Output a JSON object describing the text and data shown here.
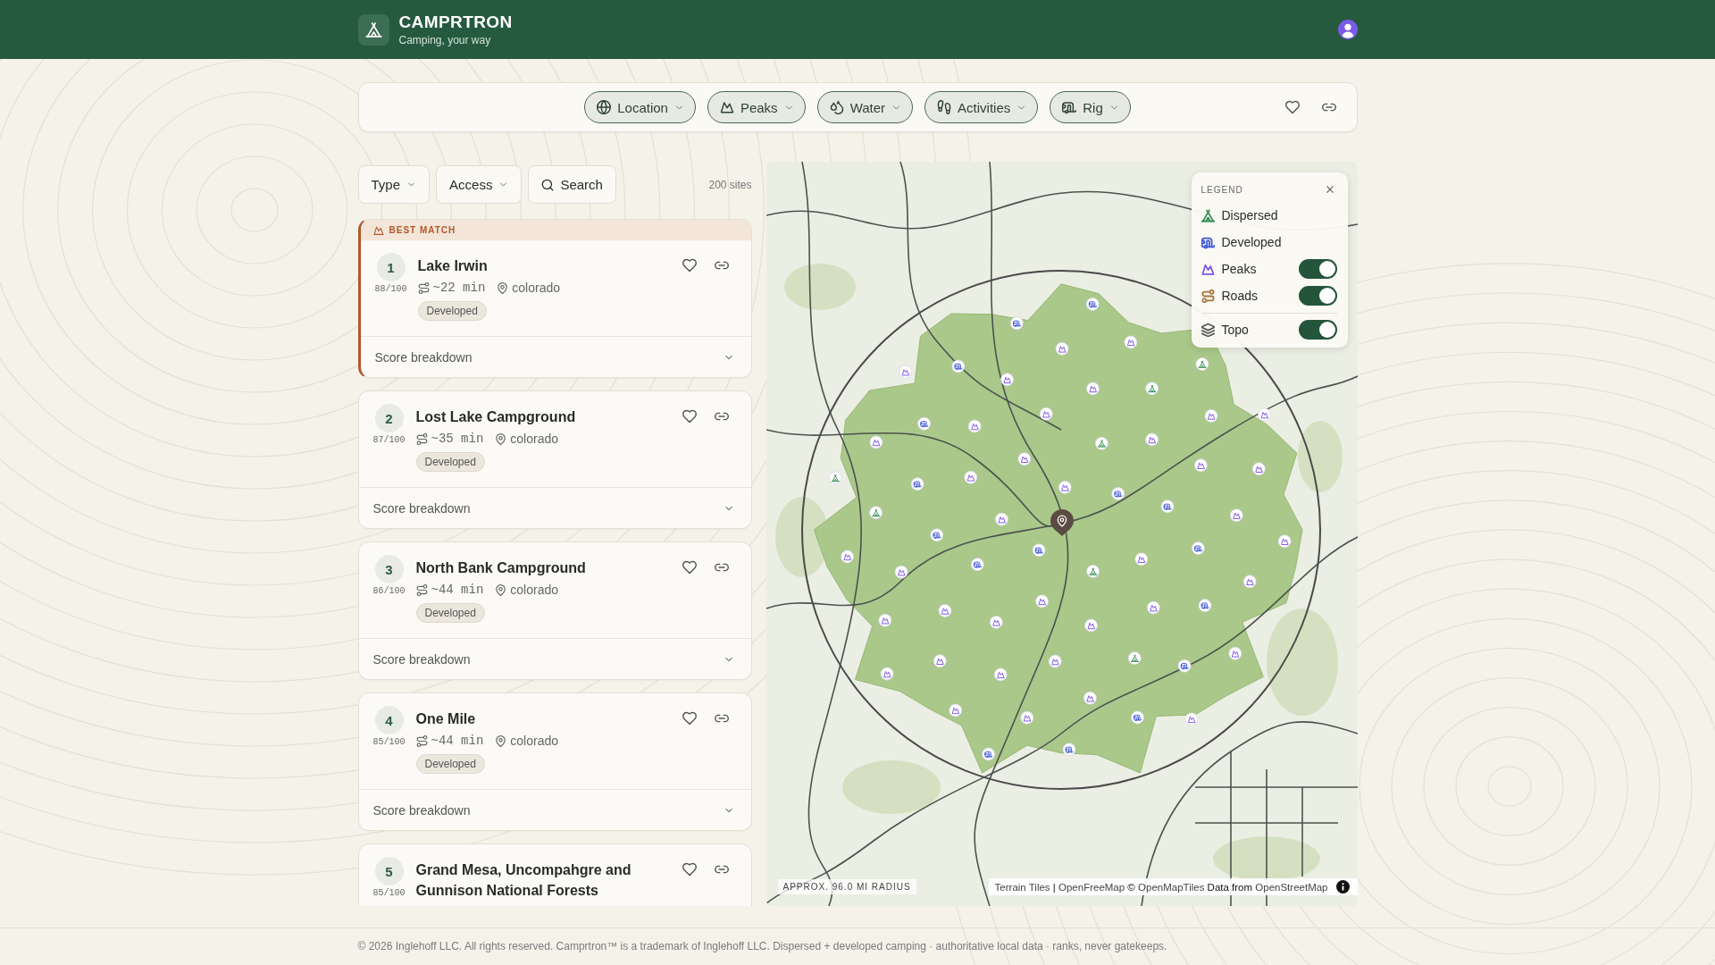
{
  "header": {
    "brand": "CAMPRTRON",
    "tagline": "Camping, your way"
  },
  "filter_bar": {
    "filters": [
      {
        "label": "Location"
      },
      {
        "label": "Peaks"
      },
      {
        "label": "Water"
      },
      {
        "label": "Activities"
      },
      {
        "label": "Rig"
      }
    ]
  },
  "list_controls": {
    "dropdowns": [
      {
        "label": "Type"
      },
      {
        "label": "Access"
      }
    ],
    "search": {
      "label": "Search"
    },
    "count": "200 sites"
  },
  "results": [
    {
      "rank": "1",
      "score": "88/100",
      "name": "Lake Irwin",
      "drive_time": "~22 min",
      "region": "colorado",
      "badge": "Developed",
      "best_match": true,
      "banner": "BEST MATCH",
      "favorite": false,
      "breakdown": "Score breakdown",
      "expanded": false
    },
    {
      "rank": "2",
      "score": "87/100",
      "name": "Lost Lake Campground",
      "drive_time": "~35 min",
      "region": "colorado",
      "badge": "Developed",
      "best_match": false,
      "favorite": false,
      "breakdown": "Score breakdown",
      "expanded": false
    },
    {
      "rank": "3",
      "score": "86/100",
      "name": "North Bank Campground",
      "drive_time": "~44 min",
      "region": "colorado",
      "badge": "Developed",
      "best_match": false,
      "favorite": false,
      "breakdown": "Score breakdown",
      "expanded": false
    },
    {
      "rank": "4",
      "score": "85/100",
      "name": "One Mile",
      "drive_time": "~44 min",
      "region": "colorado",
      "badge": "Developed",
      "best_match": false,
      "favorite": false,
      "breakdown": "Score breakdown",
      "expanded": false
    },
    {
      "rank": "5",
      "score": "85/100",
      "name": "Grand Mesa, Uncompahgre and Gunnison National Forests",
      "best_match": false,
      "favorite": false
    }
  ],
  "map": {
    "radius_label": "APPROX. 96.0 MI RADIUS",
    "attribution": [
      {
        "text": "Terrain Tiles",
        "kind": "link"
      },
      {
        "text": "|",
        "kind": "plain"
      },
      {
        "text": "OpenFreeMap",
        "kind": "link"
      },
      {
        "text": "©",
        "kind": "plain"
      },
      {
        "text": "OpenMapTiles",
        "kind": "link"
      },
      {
        "text": "Data from",
        "kind": "plain"
      },
      {
        "text": "OpenStreetMap",
        "kind": "link"
      }
    ],
    "legend": {
      "title": "LEGEND",
      "items": [
        {
          "label": "Dispersed",
          "kind": "key",
          "color": "#2f8a4e"
        },
        {
          "label": "Developed",
          "kind": "key",
          "color": "#3d56d6"
        },
        {
          "label": "Peaks",
          "kind": "toggle",
          "color": "#7d55e6",
          "on": true
        },
        {
          "label": "Roads",
          "kind": "toggle",
          "color": "#a8743f",
          "on": true
        },
        {
          "label": "Topo",
          "kind": "base",
          "color": "#555a57",
          "on": true
        }
      ]
    }
  },
  "footer": {
    "text": "© 2026 Inglehoff LLC. All rights reserved. Camprtron™ is a trademark of Inglehoff LLC. Dispersed + developed camping · authoritative local data · ranks, never gatekeeps."
  }
}
